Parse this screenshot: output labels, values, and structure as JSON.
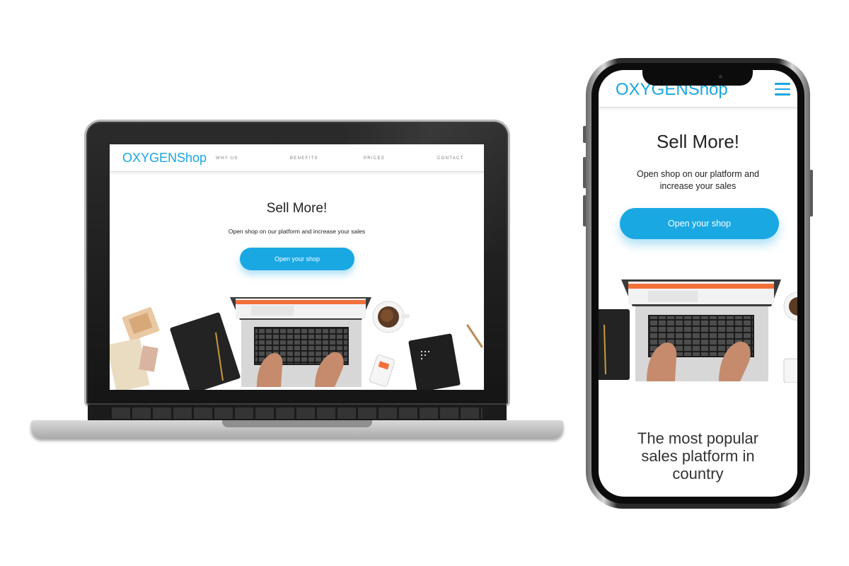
{
  "brand": {
    "name": "OXYGENShop",
    "accent": "#19a6e0"
  },
  "desktop": {
    "nav": [
      {
        "label": "WHY US"
      },
      {
        "label": "BENEFITS"
      },
      {
        "label": "PRICES"
      },
      {
        "label": "CONTACT"
      }
    ],
    "hero": {
      "title": "Sell More!",
      "subtitle": "Open shop on our platform and increase your sales",
      "cta": "Open your shop"
    }
  },
  "mobile": {
    "menu_icon": "hamburger-icon",
    "hero": {
      "title": "Sell More!",
      "subtitle": "Open shop on our platform and increase your sales",
      "cta": "Open your shop"
    },
    "section_title": "The most popular sales platform in country"
  }
}
